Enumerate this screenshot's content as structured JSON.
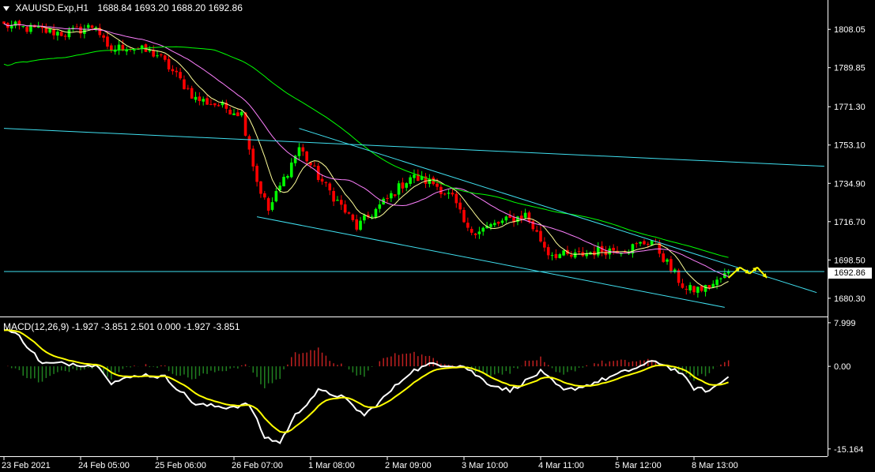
{
  "header": {
    "symbol": "XAUUSD.Exp,H1",
    "ohlc": "1688.84 1693.20 1688.20 1692.86"
  },
  "macd": {
    "label": "MACD(12,26,9) -1.927 -3.851 2.501 0.000 -1.927 -3.851"
  },
  "current_price_label": "1692.86",
  "colors": {
    "background": "#000000",
    "bull_candle": "#00ff00",
    "bear_candle": "#ff0000",
    "ma_fast": "#ffff99",
    "ma_mid": "#ff80ff",
    "ma_slow": "#00ff00",
    "trendline": "#40e0f0",
    "macd_line": "#ffffff",
    "signal_line": "#ffff00",
    "hist_pos": "#c02020",
    "hist_neg": "#208020",
    "arrow": "#ffff00"
  },
  "chart_data": [
    {
      "type": "line",
      "panel": "price",
      "ylim": [
        1672,
        1822
      ],
      "y_ticks": [
        "1808.05",
        "1789.85",
        "1771.30",
        "1753.10",
        "1734.90",
        "1716.70",
        "1698.50",
        "1680.30"
      ],
      "y_tick_values": [
        1808.05,
        1789.85,
        1771.3,
        1753.1,
        1734.9,
        1716.7,
        1698.5,
        1680.3
      ],
      "x_ticks": [
        "23 Feb 2021",
        "24 Feb 05:00",
        "25 Feb 06:00",
        "26 Feb 07:00",
        "1 Mar 08:00",
        "2 Mar 09:00",
        "3 Mar 10:00",
        "4 Mar 11:00",
        "5 Mar 12:00",
        "8 Mar 13:00"
      ],
      "x_tick_index": [
        0,
        20,
        40,
        60,
        80,
        100,
        120,
        140,
        160,
        180
      ],
      "n_bars": 190,
      "price_anchors": [
        [
          0,
          1810
        ],
        [
          8,
          1808
        ],
        [
          16,
          1806
        ],
        [
          24,
          1810
        ],
        [
          27,
          1798
        ],
        [
          32,
          1800
        ],
        [
          40,
          1796
        ],
        [
          45,
          1786
        ],
        [
          50,
          1775
        ],
        [
          56,
          1772
        ],
        [
          62,
          1768
        ],
        [
          66,
          1736
        ],
        [
          69,
          1722
        ],
        [
          77,
          1752
        ],
        [
          82,
          1738
        ],
        [
          88,
          1724
        ],
        [
          92,
          1714
        ],
        [
          98,
          1724
        ],
        [
          106,
          1738
        ],
        [
          112,
          1735
        ],
        [
          117,
          1728
        ],
        [
          121,
          1712
        ],
        [
          126,
          1714
        ],
        [
          136,
          1720
        ],
        [
          142,
          1702
        ],
        [
          148,
          1700
        ],
        [
          155,
          1703
        ],
        [
          163,
          1704
        ],
        [
          169,
          1708
        ],
        [
          174,
          1694
        ],
        [
          178,
          1684
        ],
        [
          183,
          1685
        ],
        [
          186,
          1688
        ],
        [
          189,
          1692.86
        ]
      ],
      "series": [
        {
          "name": "",
          "role": "ma_fast",
          "period": 8
        },
        {
          "name": "",
          "role": "ma_mid",
          "period": 20
        },
        {
          "name": "",
          "role": "ma_slow",
          "period": 55
        }
      ],
      "trendlines": [
        {
          "p1": [
            0,
            1761
          ],
          "p2": [
            214,
            1743
          ]
        },
        {
          "p1": [
            77,
            1761
          ],
          "p2": [
            212,
            1683
          ]
        },
        {
          "p1": [
            66,
            1719
          ],
          "p2": [
            188,
            1676
          ]
        },
        {
          "p1": [
            0,
            1693
          ],
          "p2": [
            214,
            1693
          ]
        }
      ],
      "current_price": 1692.86,
      "forecast_arrows": [
        {
          "from": [
            189,
            1690
          ],
          "to": [
            192,
            1695
          ]
        },
        {
          "from": [
            192,
            1695
          ],
          "to": [
            194.5,
            1692
          ]
        },
        {
          "from": [
            194.5,
            1692
          ],
          "to": [
            196.5,
            1695
          ]
        },
        {
          "from": [
            196.5,
            1695
          ],
          "to": [
            199,
            1690
          ]
        }
      ]
    },
    {
      "type": "bar",
      "panel": "macd",
      "ylim": [
        -16.5,
        9
      ],
      "y_ticks": [
        "7.999",
        "0.00",
        "-15.164"
      ],
      "y_tick_values": [
        7.999,
        0.0,
        -15.164
      ],
      "macd_anchors": [
        [
          0,
          7
        ],
        [
          4,
          5.5
        ],
        [
          10,
          0.5
        ],
        [
          18,
          0.5
        ],
        [
          25,
          0
        ],
        [
          28,
          -3
        ],
        [
          36,
          -1.5
        ],
        [
          42,
          -2
        ],
        [
          50,
          -7
        ],
        [
          58,
          -7.5
        ],
        [
          64,
          -7
        ],
        [
          68,
          -13
        ],
        [
          72,
          -14
        ],
        [
          76,
          -9
        ],
        [
          82,
          -4.5
        ],
        [
          88,
          -5.5
        ],
        [
          94,
          -9
        ],
        [
          98,
          -6.5
        ],
        [
          106,
          -1
        ],
        [
          112,
          0.5
        ],
        [
          120,
          0
        ],
        [
          126,
          -3
        ],
        [
          132,
          -4.5
        ],
        [
          140,
          -1
        ],
        [
          146,
          -4.5
        ],
        [
          152,
          -3.5
        ],
        [
          160,
          -1.5
        ],
        [
          170,
          1
        ],
        [
          176,
          -1
        ],
        [
          180,
          -4
        ],
        [
          184,
          -4.5
        ],
        [
          189,
          -1.927
        ]
      ]
    }
  ]
}
